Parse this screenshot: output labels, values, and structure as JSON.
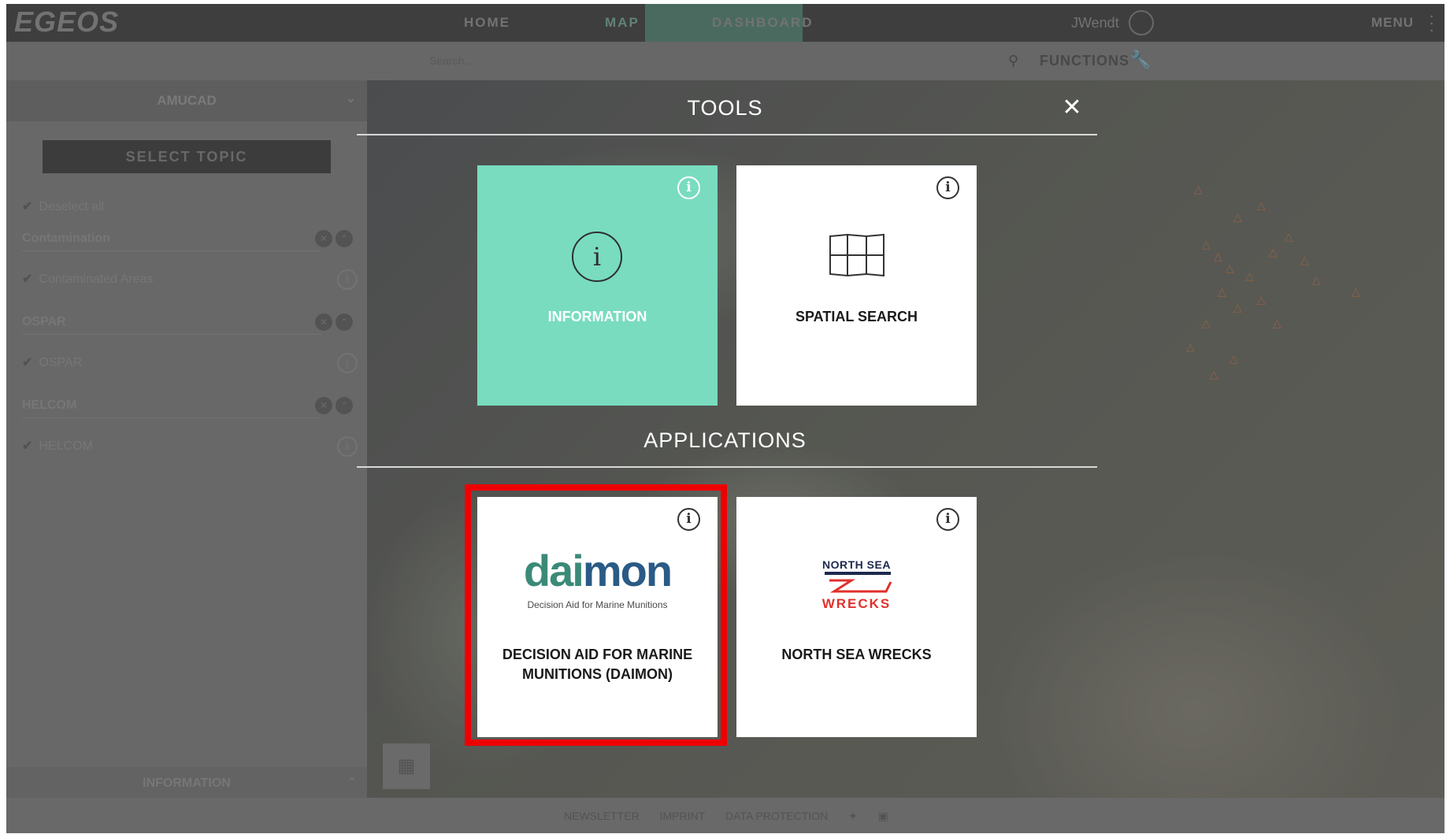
{
  "app": {
    "logo": "EGEOS",
    "nav": {
      "home": "HOME",
      "map": "MAP",
      "dashboard": "DASHBOARD"
    },
    "user": "JWendt",
    "menu": "MENU",
    "search_placeholder": "Search...",
    "functions": "FUNCTIONS"
  },
  "sidebar": {
    "title": "AMUCAD",
    "select_topic": "SELECT TOPIC",
    "deselect_all": "Deselect all",
    "groups": [
      {
        "name": "Contamination",
        "items": [
          "Contaminated Areas"
        ]
      },
      {
        "name": "OSPAR",
        "items": [
          "OSPAR"
        ]
      },
      {
        "name": "HELCOM",
        "items": [
          "HELCOM"
        ]
      }
    ],
    "bottom_panel": "INFORMATION"
  },
  "footer": {
    "links": [
      "NEWSLETTER",
      "IMPRINT",
      "DATA PROTECTION"
    ]
  },
  "modal": {
    "tools_title": "TOOLS",
    "applications_title": "APPLICATIONS",
    "tools": [
      {
        "label": "INFORMATION",
        "active": true
      },
      {
        "label": "SPATIAL SEARCH",
        "active": false
      }
    ],
    "applications": [
      {
        "label": "DECISION AID FOR MARINE MUNITIONS (DAIMON)",
        "logo_text": "daimon",
        "logo_tagline": "Decision Aid for Marine Munitions",
        "highlighted": true
      },
      {
        "label": "NORTH SEA WRECKS",
        "logo_top": "NORTH SEA",
        "logo_bottom": "WRECKS"
      }
    ]
  },
  "colors": {
    "accent_teal": "#79dcbf",
    "highlight_red": "#ee0000",
    "daimon_green": "#3b8a78",
    "daimon_blue": "#2a5b86",
    "nsw_navy": "#1d2a4e",
    "nsw_red": "#e0312b"
  }
}
